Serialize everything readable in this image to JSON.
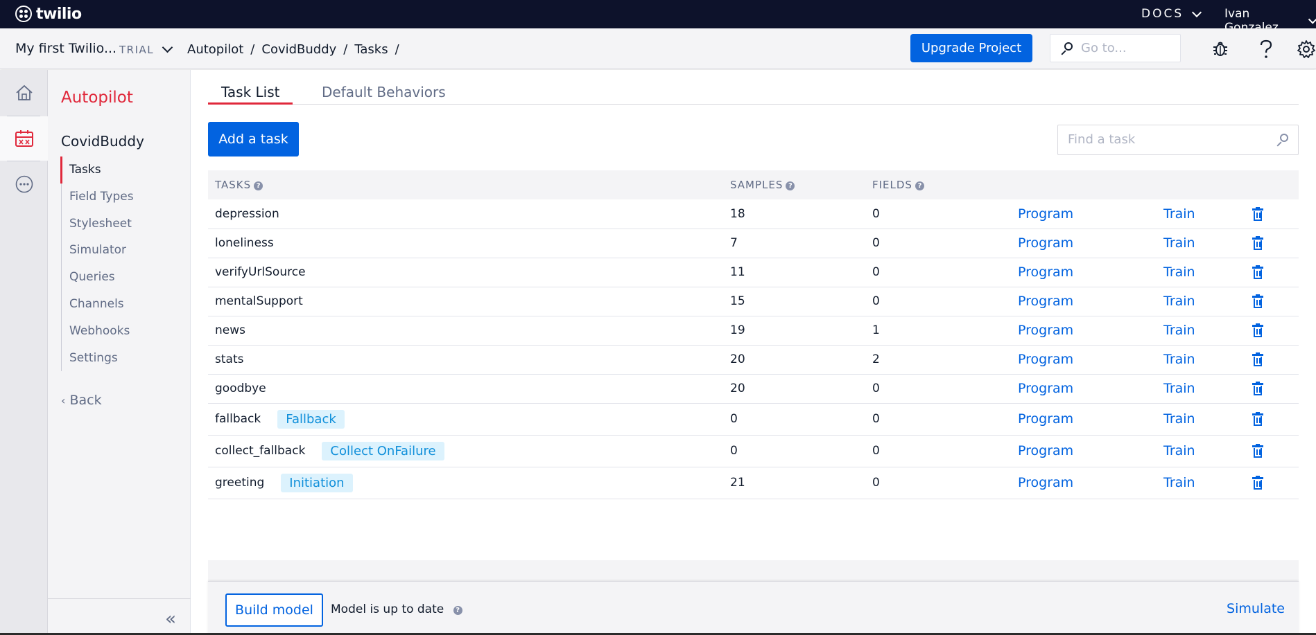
{
  "topbar": {
    "logo_text": "twilio",
    "docs_label": "DOCS",
    "user_name": "Ivan Gonzalez"
  },
  "projectbar": {
    "project_name": "My first Twilio...",
    "trial_label": "TRIAL",
    "breadcrumbs": [
      "Autopilot",
      "CovidBuddy",
      "Tasks"
    ],
    "breadcrumb_sep": "/",
    "upgrade_label": "Upgrade Project",
    "goto_placeholder": "Go to..."
  },
  "rail": {
    "items": [
      "home-icon",
      "autopilot-icon",
      "more-icon"
    ]
  },
  "sidenav": {
    "title": "Autopilot",
    "assistant": "CovidBuddy",
    "items": [
      "Tasks",
      "Field Types",
      "Stylesheet",
      "Simulator",
      "Queries",
      "Channels",
      "Webhooks",
      "Settings"
    ],
    "active": "Tasks",
    "back_label": "Back",
    "collapse_glyph": "«"
  },
  "main": {
    "tabs": [
      "Task List",
      "Default Behaviors"
    ],
    "add_task_label": "Add a task",
    "find_placeholder": "Find a task",
    "columns": [
      "TASKS",
      "SAMPLES",
      "FIELDS"
    ],
    "help_glyph": "?",
    "program_label": "Program",
    "train_label": "Train",
    "rows": [
      {
        "name": "depression",
        "badge": "",
        "samples": "18",
        "fields": "0"
      },
      {
        "name": "loneliness",
        "badge": "",
        "samples": "7",
        "fields": "0"
      },
      {
        "name": "verifyUrlSource",
        "badge": "",
        "samples": "11",
        "fields": "0"
      },
      {
        "name": "mentalSupport",
        "badge": "",
        "samples": "15",
        "fields": "0"
      },
      {
        "name": "news",
        "badge": "",
        "samples": "19",
        "fields": "1"
      },
      {
        "name": "stats",
        "badge": "",
        "samples": "20",
        "fields": "2"
      },
      {
        "name": "goodbye",
        "badge": "",
        "samples": "20",
        "fields": "0"
      },
      {
        "name": "fallback",
        "badge": "Fallback",
        "samples": "0",
        "fields": "0"
      },
      {
        "name": "collect_fallback",
        "badge": "Collect OnFailure",
        "samples": "0",
        "fields": "0"
      },
      {
        "name": "greeting",
        "badge": "Initiation",
        "samples": "21",
        "fields": "0"
      }
    ]
  },
  "footer": {
    "build_label": "Build model",
    "status": "Model is up to date",
    "simulate_label": "Simulate"
  },
  "colors": {
    "accent_red": "#e0283b",
    "primary_blue": "#0263e0",
    "topbar_navy": "#0d122b",
    "badge_bg": "#dcf2fd"
  }
}
